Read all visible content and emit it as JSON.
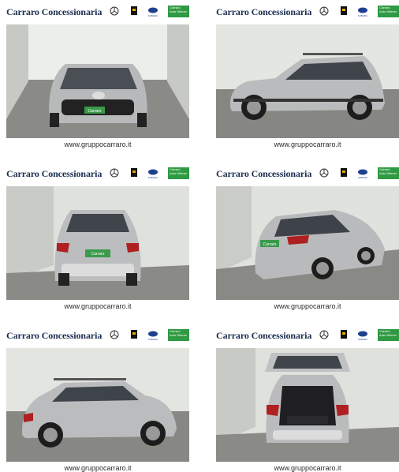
{
  "brand": "Carraro Concessionaria",
  "dealer_badge": [
    "Carraro",
    "Auto Wiener"
  ],
  "caption": "www.gruppocarraro.it",
  "logos": [
    "mercedes-logo",
    "smart-logo",
    "subaru-logo"
  ],
  "subaru_label": "SUBARU",
  "photos": [
    {
      "view": "front",
      "plate_text": "Carraro"
    },
    {
      "view": "side-right",
      "plate_text": ""
    },
    {
      "view": "rear",
      "plate_text": "Carraro"
    },
    {
      "view": "rear-three-quarter",
      "plate_text": "Carraro"
    },
    {
      "view": "side-left",
      "plate_text": ""
    },
    {
      "view": "rear-open-tailgate",
      "plate_text": ""
    }
  ]
}
